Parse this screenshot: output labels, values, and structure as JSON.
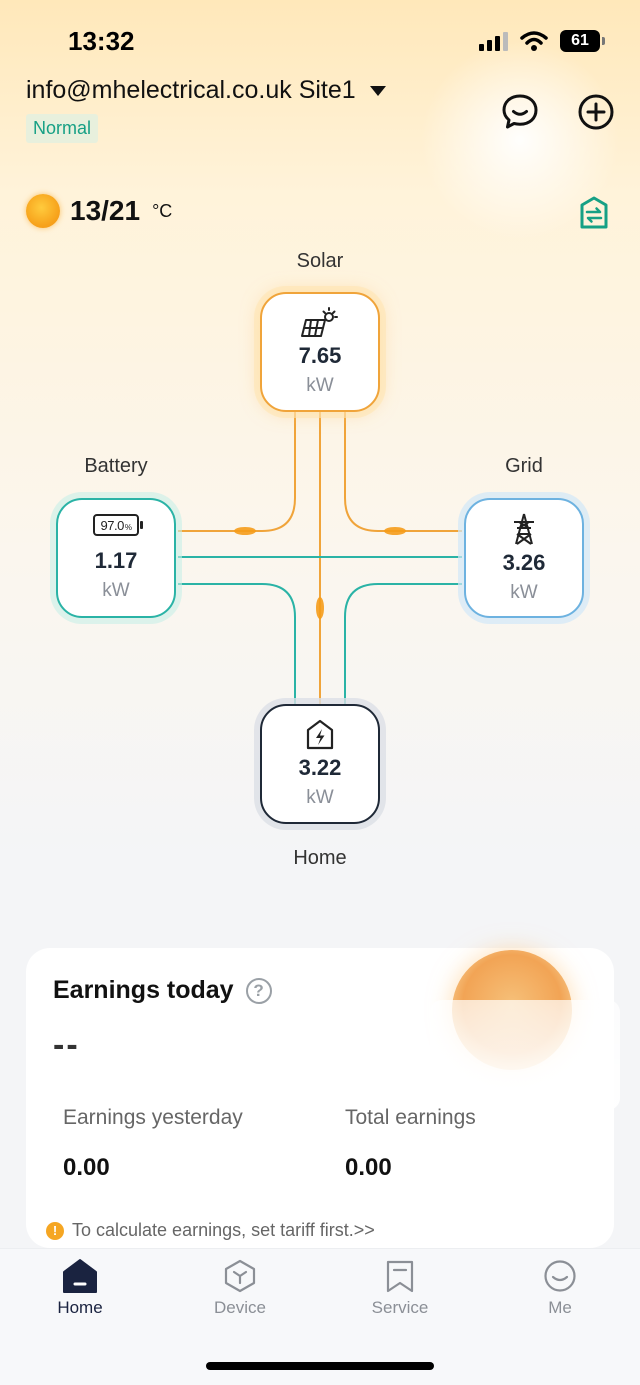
{
  "status_bar": {
    "time": "13:32",
    "battery": "61"
  },
  "header": {
    "site": "info@mhelectrical.co.uk Site1",
    "status": "Normal",
    "chat_icon": "chat-bubble-icon",
    "add_icon": "plus-circle-icon"
  },
  "weather": {
    "temp": "13/21",
    "unit": "°C"
  },
  "flow": {
    "solar": {
      "label": "Solar",
      "value": "7.65",
      "unit": "kW"
    },
    "battery": {
      "label": "Battery",
      "value": "1.17",
      "unit": "kW",
      "soc": "97.0",
      "soc_unit": "%"
    },
    "grid": {
      "label": "Grid",
      "value": "3.26",
      "unit": "kW"
    },
    "home": {
      "label": "Home",
      "value": "3.22",
      "unit": "kW"
    }
  },
  "earnings": {
    "title": "Earnings today",
    "today_value": "--",
    "yesterday_label": "Earnings yesterday",
    "yesterday_value": "0.00",
    "total_label": "Total earnings",
    "total_value": "0.00",
    "tariff_note": "To calculate earnings, set tariff first.>>"
  },
  "tabs": [
    {
      "label": "Home",
      "icon": "home-icon",
      "active": true
    },
    {
      "label": "Device",
      "icon": "device-icon",
      "active": false
    },
    {
      "label": "Service",
      "icon": "bookmark-icon",
      "active": false
    },
    {
      "label": "Me",
      "icon": "smiley-icon",
      "active": false
    }
  ],
  "colors": {
    "solar": "#f0a43a",
    "battery": "#2ab3a6",
    "grid": "#6db2e0",
    "accent": "#16a085"
  }
}
